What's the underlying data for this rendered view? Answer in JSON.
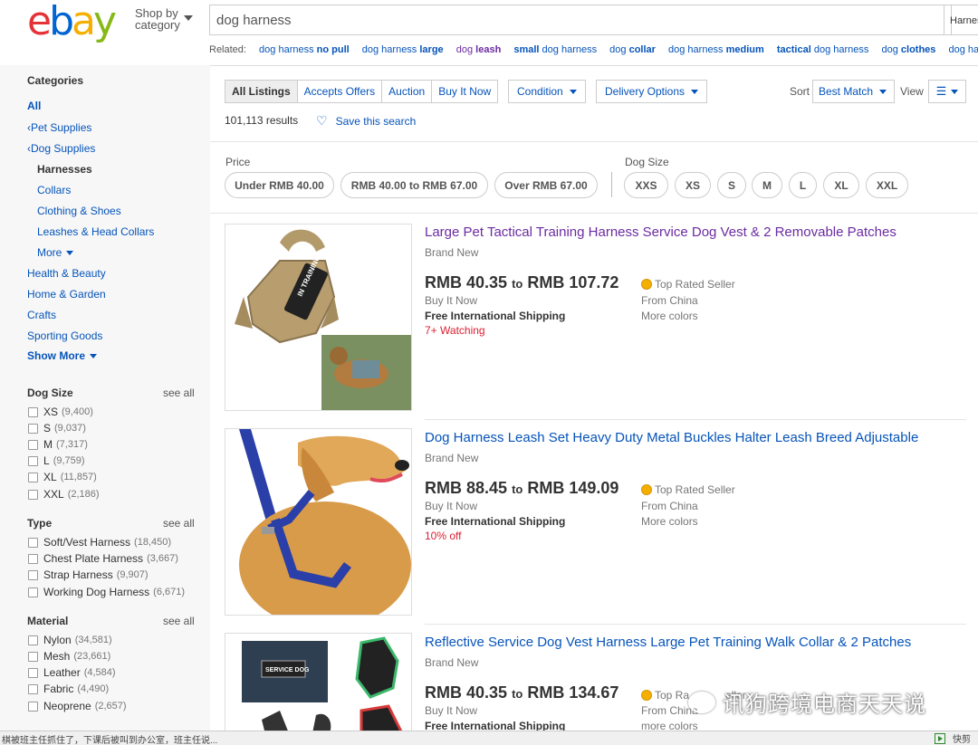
{
  "header": {
    "logo_letters": [
      "e",
      "b",
      "a",
      "y"
    ],
    "shop_by": "Shop by",
    "category": "category",
    "search_value": "dog harness",
    "search_category": "Harness",
    "related_label": "Related:",
    "related": [
      {
        "pre": "dog harness ",
        "bold": "no pull"
      },
      {
        "pre": "dog harness ",
        "bold": "large"
      },
      {
        "pre": "dog ",
        "bold": "leash"
      },
      {
        "pre": "",
        "bold": "small",
        "post": " dog harness"
      },
      {
        "pre": "dog ",
        "bold": "collar"
      },
      {
        "pre": "dog harness ",
        "bold": "medium"
      },
      {
        "pre": "",
        "bold": "tactical",
        "post": " dog harness"
      },
      {
        "pre": "dog ",
        "bold": "clothes"
      },
      {
        "pre": "dog harn",
        "bold": ""
      }
    ]
  },
  "sidebar": {
    "categories_title": "Categories",
    "all": "All",
    "pet_supplies": "Pet Supplies",
    "dog_supplies": "Dog Supplies",
    "current": "Harnesses",
    "sub": [
      "Collars",
      "Clothing & Shoes",
      "Leashes & Head Collars"
    ],
    "more": "More",
    "top": [
      "Health & Beauty",
      "Home & Garden",
      "Crafts",
      "Sporting Goods"
    ],
    "show_more": "Show More",
    "see_all": "see all",
    "dog_size": {
      "title": "Dog Size",
      "items": [
        {
          "label": "XS",
          "count": "(9,400)"
        },
        {
          "label": "S",
          "count": "(9,037)"
        },
        {
          "label": "M",
          "count": "(7,317)"
        },
        {
          "label": "L",
          "count": "(9,759)"
        },
        {
          "label": "XL",
          "count": "(11,857)"
        },
        {
          "label": "XXL",
          "count": "(2,186)"
        }
      ]
    },
    "type": {
      "title": "Type",
      "items": [
        {
          "label": "Soft/Vest Harness",
          "count": "(18,450)"
        },
        {
          "label": "Chest Plate Harness",
          "count": "(3,667)"
        },
        {
          "label": "Strap Harness",
          "count": "(9,907)"
        },
        {
          "label": "Working Dog Harness",
          "count": "(6,671)"
        }
      ]
    },
    "material": {
      "title": "Material",
      "items": [
        {
          "label": "Nylon",
          "count": "(34,581)"
        },
        {
          "label": "Mesh",
          "count": "(23,661)"
        },
        {
          "label": "Leather",
          "count": "(4,584)"
        },
        {
          "label": "Fabric",
          "count": "(4,490)"
        },
        {
          "label": "Neoprene",
          "count": "(2,657)"
        }
      ]
    }
  },
  "toolbar": {
    "tabs": [
      "All Listings",
      "Accepts Offers",
      "Auction",
      "Buy It Now"
    ],
    "condition": "Condition",
    "delivery": "Delivery Options",
    "sort_label": "Sort",
    "sort_value": "Best Match",
    "view_label": "View",
    "results": "101,113 results",
    "save_search": "Save this search"
  },
  "filters": {
    "price_label": "Price",
    "price_pills": [
      "Under RMB 40.00",
      "RMB 40.00 to RMB 67.00",
      "Over RMB 67.00"
    ],
    "size_label": "Dog Size",
    "size_pills": [
      "XXS",
      "XS",
      "S",
      "M",
      "L",
      "XL",
      "XXL"
    ]
  },
  "listings": [
    {
      "title": "Large Pet Tactical Training Harness Service Dog Vest & 2 Removable Patches",
      "condition": "Brand New",
      "price_low": "RMB 40.35",
      "to": "to",
      "price_high": "RMB 107.72",
      "format": "Buy It Now",
      "shipping": "Free International Shipping",
      "hot": "7+ Watching",
      "seller": "Top Rated Seller",
      "from": "From China",
      "colors": "More colors",
      "patch_text": "IN TRAINING"
    },
    {
      "title": "Dog Harness Leash Set Heavy Duty Metal Buckles Halter Leash Breed Adjustable",
      "condition": "Brand New",
      "price_low": "RMB 88.45",
      "to": "to",
      "price_high": "RMB 149.09",
      "format": "Buy It Now",
      "shipping": "Free International Shipping",
      "hot": "10% off",
      "seller": "Top Rated Seller",
      "from": "From China",
      "colors": "More colors"
    },
    {
      "title": "Reflective Service Dog Vest Harness Large Pet Training Walk Collar & 2 Patches",
      "condition": "Brand New",
      "price_low": "RMB 40.35",
      "to": "to",
      "price_high": "RMB 134.67",
      "format": "Buy It Now",
      "shipping": "Free International Shipping",
      "seller": "Top Ra",
      "seller_rest": "eller",
      "from": "From China",
      "colors": "more colors",
      "patch_text": "SERVICE DOG"
    }
  ],
  "statusbar": {
    "left": "棋被班主任抓住了，下课后被叫到办公室，班主任说...",
    "right": "快剪"
  },
  "watermark": "讯狗跨境电商天天说",
  "colors": {
    "link": "#0654ba",
    "visited": "#6b2ba1",
    "hot": "#dd1e31"
  }
}
